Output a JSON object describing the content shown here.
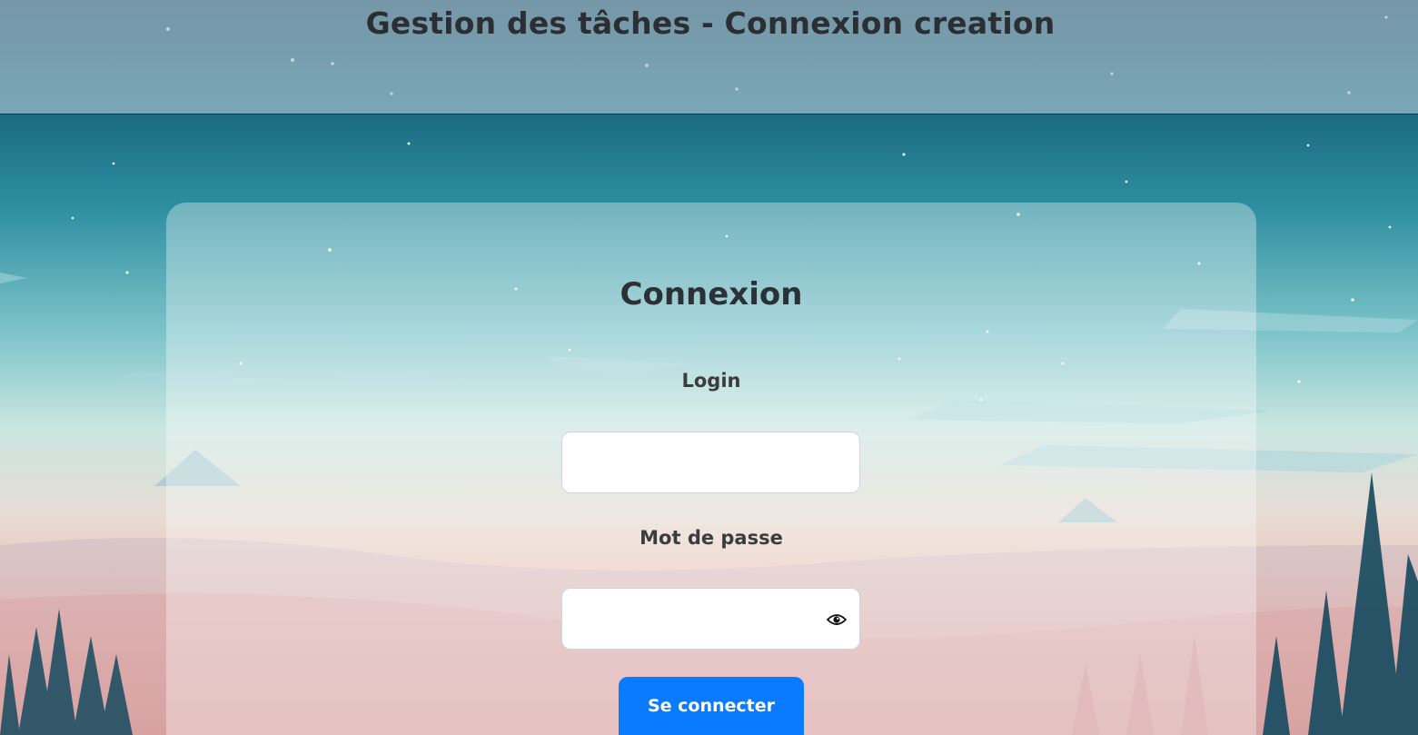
{
  "header": {
    "title": "Gestion des tâches - Connexion creation"
  },
  "login_card": {
    "title": "Connexion",
    "login_label": "Login",
    "login_value": "",
    "password_label": "Mot de passe",
    "password_value": "",
    "toggle_password_icon": "eye-icon",
    "submit_label": "Se connecter"
  },
  "colors": {
    "primary_button": "#0a7bff",
    "title_text": "#2b2f33"
  }
}
